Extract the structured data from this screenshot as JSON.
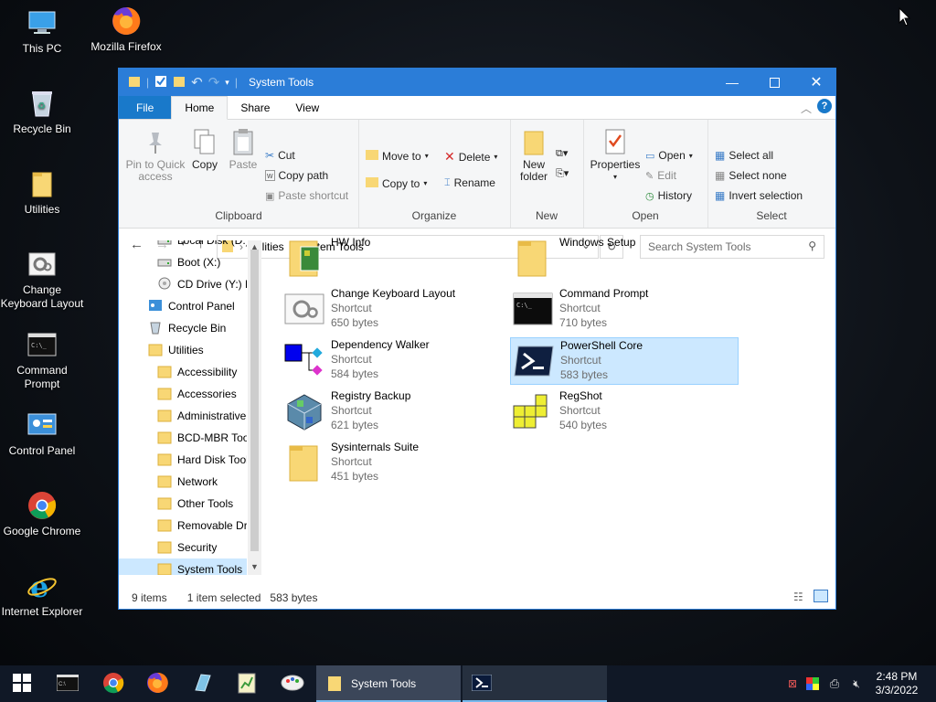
{
  "desktop": {
    "icons": [
      {
        "label": "This PC",
        "icon": "this-pc-icon"
      },
      {
        "label": "Mozilla Firefox",
        "icon": "firefox-icon"
      },
      {
        "label": "Recycle Bin",
        "icon": "recycle-bin-icon"
      },
      {
        "label": "Utilities",
        "icon": "folder-icon"
      },
      {
        "label": "Change Keyboard Layout",
        "icon": "keyboard-settings-icon"
      },
      {
        "label": "Command Prompt",
        "icon": "command-prompt-icon"
      },
      {
        "label": "Control Panel",
        "icon": "control-panel-icon"
      },
      {
        "label": "Google Chrome",
        "icon": "chrome-icon"
      },
      {
        "label": "Internet Explorer",
        "icon": "internet-explorer-icon"
      }
    ]
  },
  "window": {
    "title": "System Tools",
    "tabs": {
      "file": "File",
      "home": "Home",
      "share": "Share",
      "view": "View"
    },
    "ribbon": {
      "pin_line1": "Pin to Quick",
      "pin_line2": "access",
      "copy": "Copy",
      "paste": "Paste",
      "cut": "Cut",
      "copy_path": "Copy path",
      "paste_shortcut": "Paste shortcut",
      "clipboard": "Clipboard",
      "move_to": "Move to",
      "copy_to": "Copy to",
      "delete": "Delete",
      "rename": "Rename",
      "organize": "Organize",
      "new_folder_line1": "New",
      "new_folder_line2": "folder",
      "new": "New",
      "properties": "Properties",
      "open": "Open",
      "edit": "Edit",
      "history": "History",
      "open_group": "Open",
      "select_all": "Select all",
      "select_none": "Select none",
      "invert_selection": "Invert selection",
      "select": "Select"
    },
    "address": {
      "crumb1": "Utilities",
      "crumb2": "System Tools",
      "search_placeholder": "Search System Tools"
    },
    "nav": [
      {
        "label": "Local Disk (D:)",
        "icon": "drive-icon"
      },
      {
        "label": "Boot (X:)",
        "icon": "drive-icon"
      },
      {
        "label": "CD Drive (Y:) H",
        "icon": "cd-drive-icon"
      },
      {
        "label": "Control Panel",
        "icon": "control-panel-icon"
      },
      {
        "label": "Recycle Bin",
        "icon": "recycle-bin-icon"
      },
      {
        "label": "Utilities",
        "icon": "folder-icon"
      },
      {
        "label": "Accessibility",
        "icon": "folder-icon"
      },
      {
        "label": "Accessories",
        "icon": "folder-icon"
      },
      {
        "label": "Administrative",
        "icon": "folder-icon"
      },
      {
        "label": "BCD-MBR Tool",
        "icon": "folder-icon"
      },
      {
        "label": "Hard Disk Tools",
        "icon": "folder-icon"
      },
      {
        "label": "Network",
        "icon": "folder-icon"
      },
      {
        "label": "Other Tools",
        "icon": "folder-icon"
      },
      {
        "label": "Removable Driv",
        "icon": "folder-icon"
      },
      {
        "label": "Security",
        "icon": "folder-icon"
      },
      {
        "label": "System Tools",
        "icon": "folder-icon"
      }
    ],
    "files": [
      {
        "name": "HW Info",
        "type": "",
        "size": "",
        "icon": "hwinfo-folder-icon"
      },
      {
        "name": "Windows Setup",
        "type": "",
        "size": "",
        "icon": "folder-icon"
      },
      {
        "name": "Change Keyboard Layout",
        "type": "Shortcut",
        "size": "650 bytes",
        "icon": "keyboard-settings-icon"
      },
      {
        "name": "Command Prompt",
        "type": "Shortcut",
        "size": "710 bytes",
        "icon": "command-prompt-icon"
      },
      {
        "name": "Dependency Walker",
        "type": "Shortcut",
        "size": "584 bytes",
        "icon": "dependency-walker-icon"
      },
      {
        "name": "PowerShell Core",
        "type": "Shortcut",
        "size": "583 bytes",
        "icon": "powershell-icon"
      },
      {
        "name": "Registry Backup",
        "type": "Shortcut",
        "size": "621 bytes",
        "icon": "registry-backup-icon"
      },
      {
        "name": "RegShot",
        "type": "Shortcut",
        "size": "540 bytes",
        "icon": "regshot-icon"
      },
      {
        "name": "Sysinternals Suite",
        "type": "Shortcut",
        "size": "451 bytes",
        "icon": "folder-icon"
      }
    ],
    "status": {
      "count": "9 items",
      "selected": "1 item selected",
      "size": "583 bytes"
    }
  },
  "taskbar": {
    "explorer_label": "System Tools",
    "time": "2:48 PM",
    "date": "3/3/2022"
  },
  "colors": {
    "accent": "#2b7dd8",
    "selection": "#cce8ff",
    "taskbar": "#101826"
  }
}
